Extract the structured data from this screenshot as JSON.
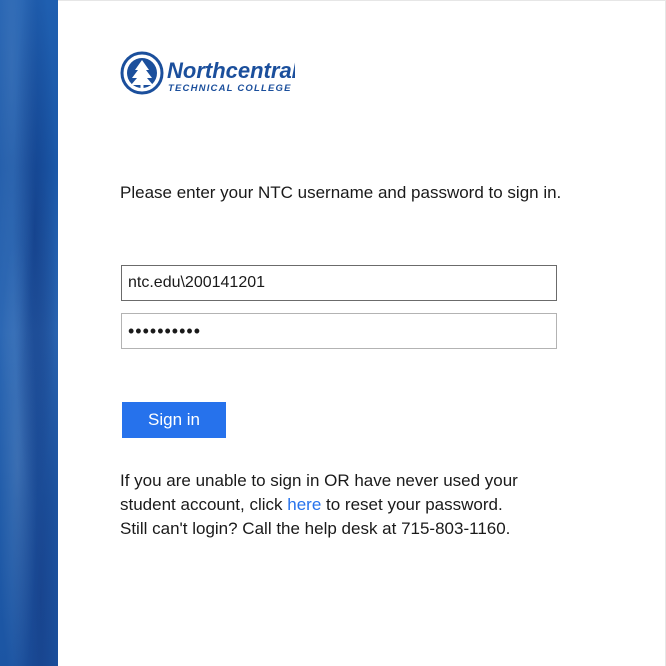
{
  "logo": {
    "name": "Northcentral",
    "subtitle": "TECHNICAL COLLEGE",
    "color": "#1b4f9c"
  },
  "login": {
    "instructions": "Please enter your NTC username and password to sign in.",
    "username_value": "ntc.edu\\200141201",
    "password_value": "••••••••••",
    "signin_label": "Sign in"
  },
  "help": {
    "text_before_link": "If you are unable to sign in OR have never used your student account, click ",
    "link_label": "here",
    "text_after_link": " to reset your password.",
    "helpdesk_text": "Still can't login? Call the help desk at 715-803-1160."
  },
  "colors": {
    "accent": "#2672ec",
    "sidebar": "#1f5fb0"
  }
}
